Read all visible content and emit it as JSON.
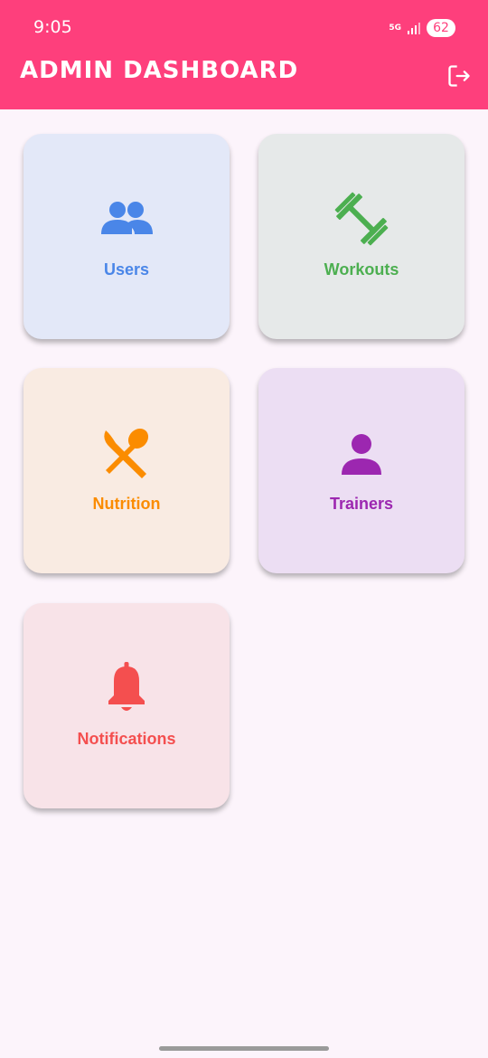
{
  "status_bar": {
    "time": "9:05",
    "network": "5G",
    "battery": "62"
  },
  "app_bar": {
    "title": "ADMIN DASHBOARD",
    "logout_icon": "logout-icon"
  },
  "cards": [
    {
      "label": "Users",
      "icon": "users-icon",
      "bg": "#e3e8f8",
      "color": "#4a86e8"
    },
    {
      "label": "Workouts",
      "icon": "dumbbell-icon",
      "bg": "#e6e9e9",
      "color": "#4caf50"
    },
    {
      "label": "Nutrition",
      "icon": "utensils-icon",
      "bg": "#f9ebe2",
      "color": "#fb8c00"
    },
    {
      "label": "Trainers",
      "icon": "person-icon",
      "bg": "#ecdef3",
      "color": "#9c27b0"
    },
    {
      "label": "Notifications",
      "icon": "bell-icon",
      "bg": "#f8e3e8",
      "color": "#f44f4f"
    }
  ]
}
